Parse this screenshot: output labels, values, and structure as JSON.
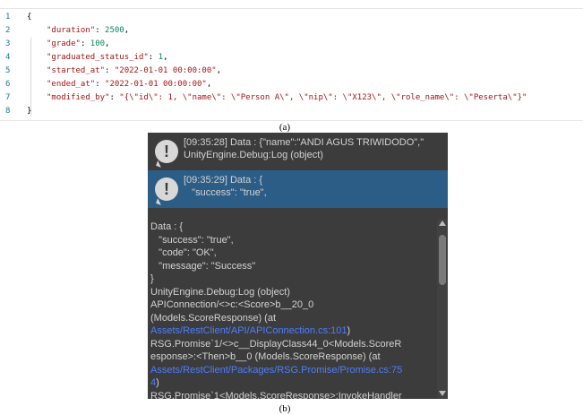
{
  "code": {
    "lines": [
      {
        "no": "1",
        "text": "{"
      },
      {
        "no": "2",
        "key": "\"duration\"",
        "value": "2500",
        "vtype": "num",
        "trail": ","
      },
      {
        "no": "3",
        "key": "\"grade\"",
        "value": "100",
        "vtype": "num",
        "trail": ","
      },
      {
        "no": "4",
        "key": "\"graduated_status_id\"",
        "value": "1",
        "vtype": "num",
        "trail": ","
      },
      {
        "no": "5",
        "key": "\"started_at\"",
        "value": "\"2022-01-01 00:00:00\"",
        "vtype": "str",
        "trail": ","
      },
      {
        "no": "6",
        "key": "\"ended_at\"",
        "value": "\"2022-01-01 00:00:00\"",
        "vtype": "str",
        "trail": ","
      },
      {
        "no": "7",
        "key": "\"modified_by\"",
        "value": "\"{\\\"id\\\": 1, \\\"name\\\": \\\"Person A\\\", \\\"nip\\\": \\\"X123\\\", \\\"role_name\\\": \\\"Peserta\\\"}\"",
        "vtype": "str",
        "trail": ""
      },
      {
        "no": "8",
        "text": "}"
      }
    ]
  },
  "captions": {
    "a": "(a)",
    "b": "(b)"
  },
  "console": {
    "entries": [
      {
        "line1": "[09:35:28] Data : {\"name\":\"ANDI AGUS TRIWIDODO\",\"",
        "line2": "UnityEngine.Debug:Log (object)",
        "selected": false
      },
      {
        "line1": "[09:35:29] Data : {",
        "line2": "   \"success\": \"true\",",
        "selected": true
      }
    ],
    "icon": "warning-exclamation-icon",
    "detail": [
      {
        "text": "Data : {"
      },
      {
        "text": "   \"success\": \"true\","
      },
      {
        "text": "   \"code\": \"OK\","
      },
      {
        "text": "   \"message\": \"Success\""
      },
      {
        "text": "}"
      },
      {
        "text": "UnityEngine.Debug:Log (object)"
      },
      {
        "text": "APIConnection/<>c:<Score>b__20_0"
      },
      {
        "text": "(Models.ScoreResponse) (at"
      },
      {
        "link": "Assets/RestClient/API/APIConnection.cs:101",
        "suffix": ")"
      },
      {
        "text": "RSG.Promise`1/<>c__DisplayClass44_0<Models.ScoreR"
      },
      {
        "text": "esponse>:<Then>b__0 (Models.ScoreResponse) (at"
      },
      {
        "link": "Assets/RestClient/Packages/RSG.Promise/Promise.cs:75"
      },
      {
        "link": "4",
        "suffix": ")"
      },
      {
        "text": "RSG.Promise`1<Models.ScoreResponse>:InvokeHandler"
      }
    ]
  }
}
